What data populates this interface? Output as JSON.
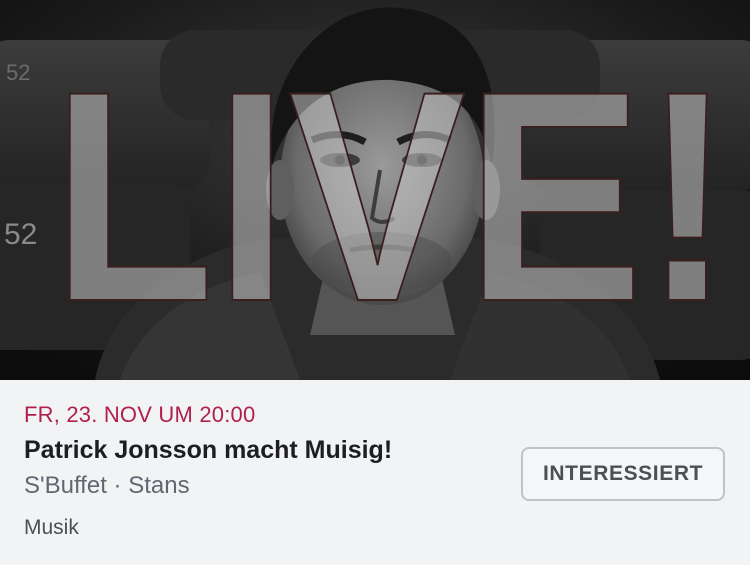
{
  "event": {
    "date": "FR, 23. NOV UM 20:00",
    "title": "Patrick Jonsson macht Muisig!",
    "location": "S'Buffet · Stans",
    "category": "Musik",
    "interest_label": "INTERESSIERT"
  },
  "poster": {
    "overlay_text": "LIVE!",
    "seat_number_top": "52",
    "seat_number_side": "52"
  },
  "colors": {
    "date": "#b11f4d",
    "background": "#f2f3f5",
    "button_border": "#bec3c9"
  }
}
